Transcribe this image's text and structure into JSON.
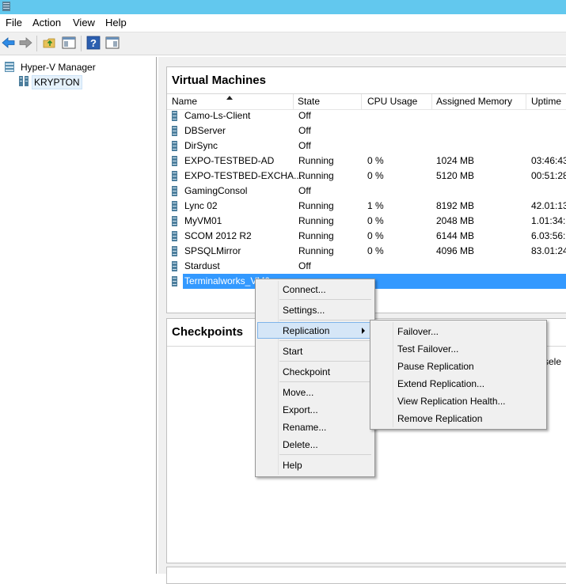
{
  "menubar": {
    "items": [
      "File",
      "Action",
      "View",
      "Help"
    ]
  },
  "toolbar": {
    "buttons": [
      "back-icon",
      "forward-icon",
      "folder-up-icon",
      "show-hide-tree-icon",
      "help-icon",
      "show-hide-action-pane-icon"
    ]
  },
  "tree": {
    "root": "Hyper-V Manager",
    "server": "KRYPTON"
  },
  "vm_panel": {
    "title": "Virtual Machines",
    "columns": [
      "Name",
      "State",
      "CPU Usage",
      "Assigned Memory",
      "Uptime"
    ],
    "rows": [
      {
        "name": "Camo-Ls-Client",
        "state": "Off",
        "cpu": "",
        "memory": "",
        "uptime": ""
      },
      {
        "name": "DBServer",
        "state": "Off",
        "cpu": "",
        "memory": "",
        "uptime": ""
      },
      {
        "name": "DirSync",
        "state": "Off",
        "cpu": "",
        "memory": "",
        "uptime": ""
      },
      {
        "name": "EXPO-TESTBED-AD",
        "state": "Running",
        "cpu": "0 %",
        "memory": "1024 MB",
        "uptime": "03:46:43"
      },
      {
        "name": "EXPO-TESTBED-EXCHA...",
        "state": "Running",
        "cpu": "0 %",
        "memory": "5120 MB",
        "uptime": "00:51:28"
      },
      {
        "name": "GamingConsol",
        "state": "Off",
        "cpu": "",
        "memory": "",
        "uptime": ""
      },
      {
        "name": "Lync 02",
        "state": "Running",
        "cpu": "1 %",
        "memory": "8192 MB",
        "uptime": "42.01:13:"
      },
      {
        "name": "MyVM01",
        "state": "Running",
        "cpu": "0 %",
        "memory": "2048 MB",
        "uptime": "1.01:34:3"
      },
      {
        "name": "SCOM 2012 R2",
        "state": "Running",
        "cpu": "0 %",
        "memory": "6144 MB",
        "uptime": "6.03:56:2"
      },
      {
        "name": "SPSQLMirror",
        "state": "Running",
        "cpu": "0 %",
        "memory": "4096 MB",
        "uptime": "83.01:24:"
      },
      {
        "name": "Stardust",
        "state": "Off",
        "cpu": "",
        "memory": "",
        "uptime": ""
      },
      {
        "name": "Terminalworks_VM0",
        "state": "",
        "cpu": "",
        "memory": "",
        "uptime": ""
      }
    ],
    "selected_index": 11
  },
  "checkpoints_panel": {
    "title": "Checkpoints",
    "hint": "e sele"
  },
  "context_menu": {
    "items": [
      "Connect...",
      "Settings...",
      "Replication",
      "Start",
      "Checkpoint",
      "Move...",
      "Export...",
      "Rename...",
      "Delete...",
      "Help"
    ]
  },
  "replication_submenu": {
    "items": [
      "Failover...",
      "Test Failover...",
      "Pause Replication",
      "Extend Replication...",
      "View Replication Health...",
      "Remove Replication"
    ]
  },
  "colors": {
    "titlebar": "#62c8ee",
    "selection": "#3399ff",
    "menu_highlight": "#d5e6f7"
  }
}
